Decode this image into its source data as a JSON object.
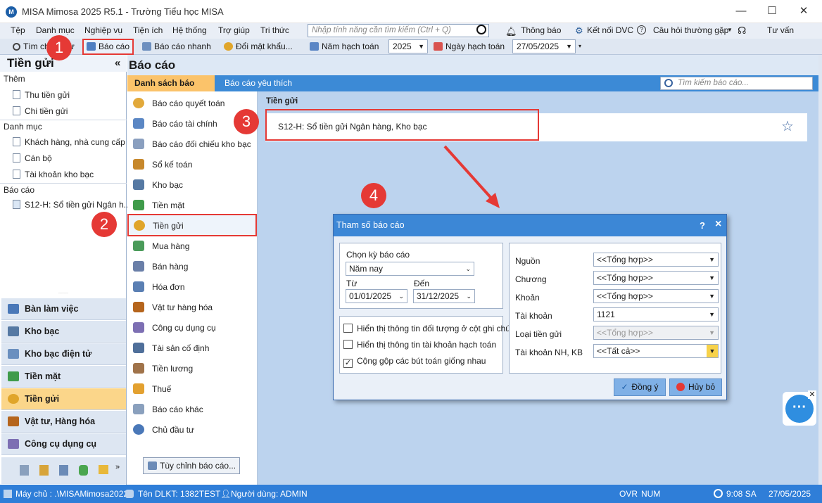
{
  "window": {
    "title": "MISA Mimosa 2025 R5.1 - Trường Tiểu học MISA",
    "minimize": "—",
    "maximize": "☐",
    "close": "✕"
  },
  "menu": {
    "items": [
      "Tệp",
      "Danh mục",
      "Nghiệp vụ",
      "Tiện ích",
      "Hệ thống",
      "Trợ giúp",
      "Tri thức"
    ],
    "search_placeholder": "Nhập tính năng cần tìm kiếm (Ctrl + Q)",
    "thong_bao": "Thông báo",
    "ket_noi": "Kết nối DVC",
    "cau_hoi": "Câu hỏi thường gặp",
    "tu_van": "Tư vấn"
  },
  "toolbar": {
    "tim": "Tìm chứng từ",
    "bao_cao": "Báo cáo",
    "bao_cao_nhanh": "Báo cáo nhanh",
    "doi_mat_khau": "Đổi mật khẩu...",
    "nam_hach_toan_label": "Năm hạch toán",
    "nam_hach_toan": "2025",
    "ngay_hach_toan_label": "Ngày hạch toán",
    "ngay_hach_toan": "27/05/2025"
  },
  "left": {
    "title": "Tiền gửi",
    "collapse": "«",
    "section_them": "Thêm",
    "them_items": [
      "Thu tiền gửi",
      "Chi tiền gửi"
    ],
    "section_danhmuc": "Danh mục",
    "danhmuc_items": [
      "Khách hàng, nhà cung cấp",
      "Cán bộ",
      "Tài khoản kho bạc"
    ],
    "section_baocao": "Báo cáo",
    "baocao_items": [
      "S12-H: Sổ tiền gửi Ngân h..."
    ],
    "nav": [
      "Bàn làm việc",
      "Kho bạc",
      "Kho bạc điện tử",
      "Tiền mặt",
      "Tiền gửi",
      "Vật tư, Hàng hóa",
      "Công cụ dụng cụ"
    ]
  },
  "content": {
    "title": "Báo cáo",
    "tab_list": "Danh sách báo cáo",
    "tab_fav": "Báo cáo yêu thích",
    "search_placeholder": "Tìm kiếm báo cáo...",
    "categories": [
      "Báo cáo quyết toán",
      "Báo cáo tài chính",
      "Báo cáo đối chiếu kho bạc",
      "Sổ kế toán",
      "Kho bạc",
      "Tiền mặt",
      "Tiền gửi",
      "Mua hàng",
      "Bán hàng",
      "Hóa đơn",
      "Vật tư hàng hóa",
      "Công cụ dụng cụ",
      "Tài sản cố định",
      "Tiền lương",
      "Thuế",
      "Báo cáo khác",
      "Chủ đầu tư"
    ],
    "customize": "Tùy chỉnh báo cáo...",
    "section": "Tiền gửi",
    "report": "S12-H: Sổ tiền gửi Ngân hàng, Kho bạc"
  },
  "dialog": {
    "title": "Tham số báo cáo",
    "help": "?",
    "close": "×",
    "period_label": "Chọn kỳ báo cáo",
    "period": "Năm nay",
    "from_label": "Từ",
    "from": "01/01/2025",
    "to_label": "Đến",
    "to": "31/12/2025",
    "chk1": "Hiển thị thông tin đối tượng ở cột ghi chú",
    "chk2": "Hiển thị thông tin tài khoản hạch toán",
    "chk3": "Cộng gộp các bút toán giống nhau",
    "nguon_label": "Nguồn",
    "nguon": "<<Tổng hợp>>",
    "chuong_label": "Chương",
    "chuong": "<<Tổng hợp>>",
    "khoan_label": "Khoản",
    "khoan": "<<Tổng hợp>>",
    "taikhoan_label": "Tài khoản",
    "taikhoan": "1121",
    "loaitien_label": "Loại tiền gửi",
    "loaitien": "<<Tổng hợp>>",
    "tknh_label": "Tài khoản NH, KB",
    "tknh": "<<Tất cả>>",
    "ok": "Đồng ý",
    "cancel": "Hủy bỏ"
  },
  "status": {
    "server": "Máy chủ : .\\MISAMimosa2022",
    "db": "Tên DLKT: 1382TEST",
    "user": "Người dùng: ADMIN",
    "ovr": "OVR",
    "num": "NUM",
    "time": "9:08 SA",
    "date": "27/05/2025"
  },
  "annotations": [
    "1",
    "2",
    "3",
    "4"
  ],
  "colors": {
    "accent": "#2f7ed8",
    "highlight": "#e53935",
    "active_nav": "#fbd68a"
  }
}
